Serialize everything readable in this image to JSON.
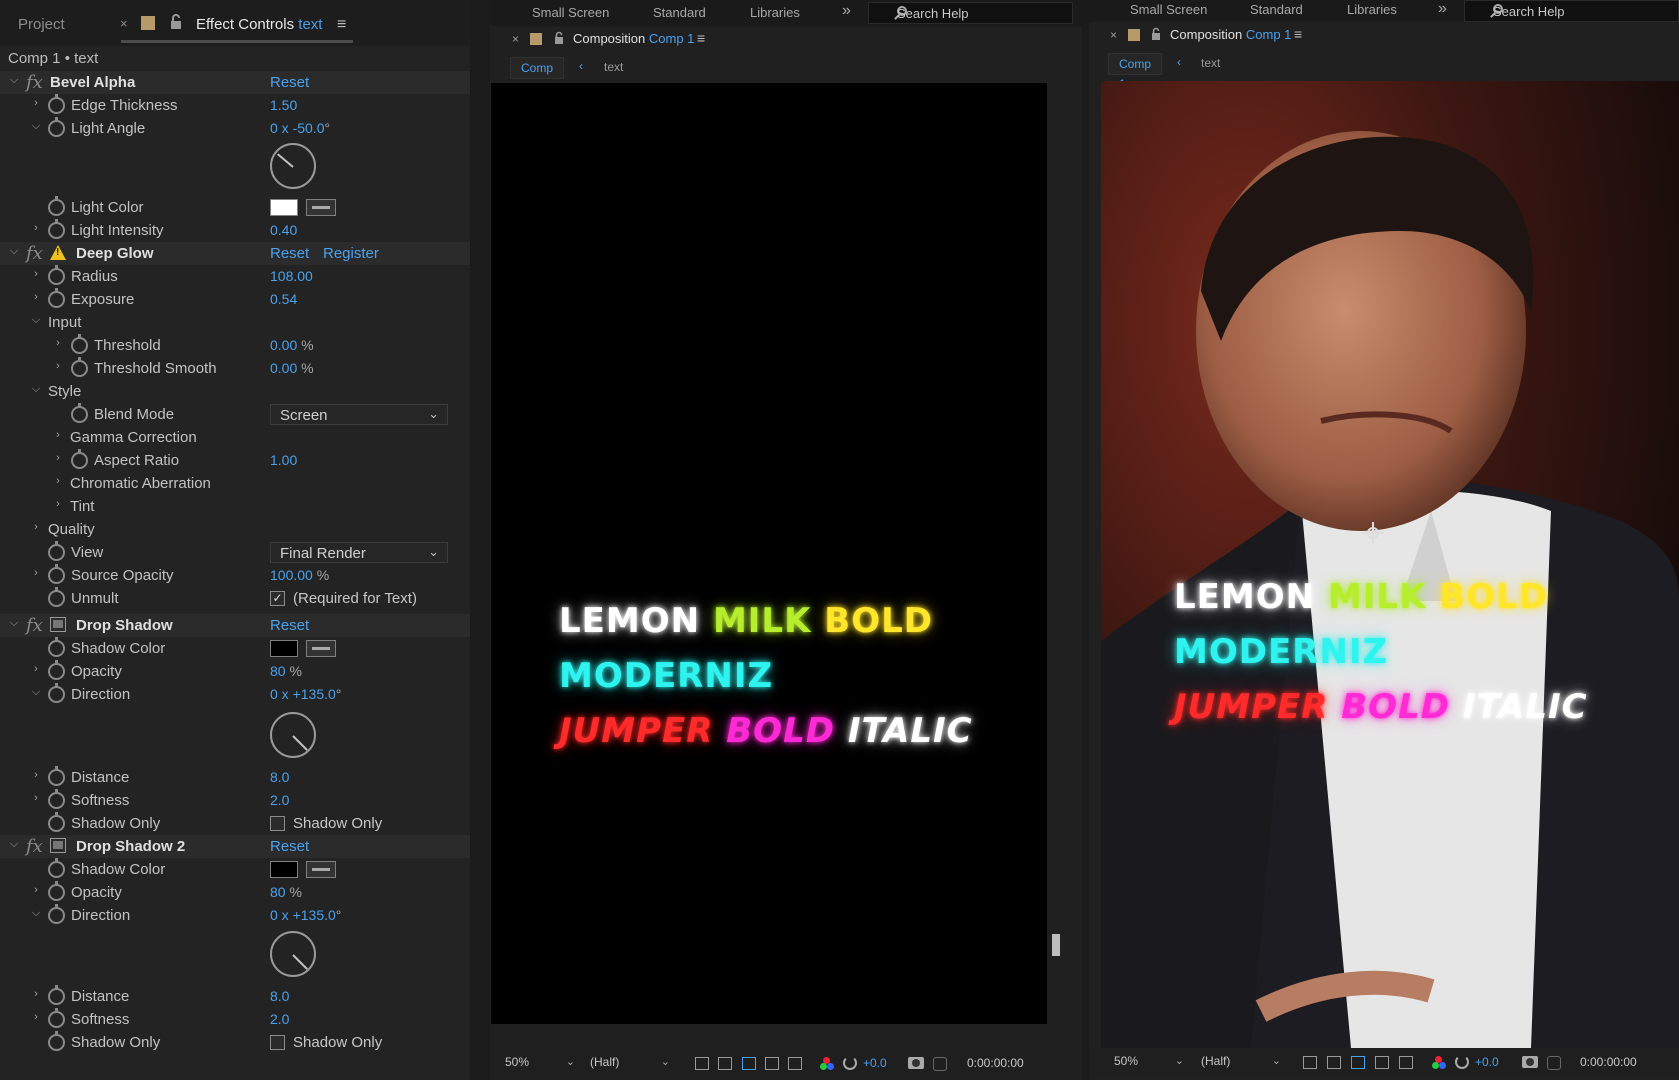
{
  "workspace": {
    "items": [
      "Small Screen",
      "Standard",
      "Libraries"
    ],
    "more": "»",
    "search_label": "Search Help"
  },
  "left_panel": {
    "project_tab": "Project",
    "close": "×",
    "effect_tab": "Effect Controls",
    "effect_tab_layer": "text",
    "menu": "≡",
    "path": "Comp 1 • text"
  },
  "effects": {
    "bevel": {
      "name": "Bevel Alpha",
      "reset": "Reset",
      "edge_thickness": {
        "label": "Edge Thickness",
        "value": "1.50"
      },
      "light_angle": {
        "label": "Light Angle",
        "value": "0 x -50.0",
        "unit": "°",
        "angle_deg": -50
      },
      "light_color": {
        "label": "Light Color",
        "color": "#ffffff"
      },
      "light_intensity": {
        "label": "Light Intensity",
        "value": "0.40"
      }
    },
    "deep_glow": {
      "name": "Deep Glow",
      "reset": "Reset",
      "register": "Register",
      "radius": {
        "label": "Radius",
        "value": "108.00"
      },
      "exposure": {
        "label": "Exposure",
        "value": "0.54"
      },
      "input": {
        "label": "Input"
      },
      "threshold": {
        "label": "Threshold",
        "value": "0.00",
        "unit": "%"
      },
      "threshold_smooth": {
        "label": "Threshold Smooth",
        "value": "0.00",
        "unit": "%"
      },
      "style": {
        "label": "Style"
      },
      "blend_mode": {
        "label": "Blend Mode",
        "value": "Screen"
      },
      "gamma": {
        "label": "Gamma Correction"
      },
      "aspect": {
        "label": "Aspect Ratio",
        "value": "1.00"
      },
      "chromatic": {
        "label": "Chromatic Aberration"
      },
      "tint": {
        "label": "Tint"
      },
      "quality": {
        "label": "Quality"
      },
      "view": {
        "label": "View",
        "value": "Final Render"
      },
      "source_opacity": {
        "label": "Source Opacity",
        "value": "100.00",
        "unit": "%"
      },
      "unmult": {
        "label": "Unmult",
        "checkbox_label": "(Required for Text)",
        "checked": true
      }
    },
    "drop_shadow": {
      "name": "Drop Shadow",
      "reset": "Reset",
      "shadow_color": {
        "label": "Shadow Color",
        "color": "#000000"
      },
      "opacity": {
        "label": "Opacity",
        "value": "80",
        "unit": "%"
      },
      "direction": {
        "label": "Direction",
        "value": "0 x +135.0",
        "unit": "°",
        "angle_deg": 135
      },
      "distance": {
        "label": "Distance",
        "value": "8.0"
      },
      "softness": {
        "label": "Softness",
        "value": "2.0"
      },
      "shadow_only": {
        "label": "Shadow Only",
        "checkbox_label": "Shadow Only",
        "checked": false
      }
    },
    "drop_shadow2": {
      "name": "Drop Shadow 2",
      "reset": "Reset",
      "shadow_color": {
        "label": "Shadow Color",
        "color": "#000000"
      },
      "opacity": {
        "label": "Opacity",
        "value": "80",
        "unit": "%"
      },
      "direction": {
        "label": "Direction",
        "value": "0 x +135.0",
        "unit": "°",
        "angle_deg": 135
      },
      "distance": {
        "label": "Distance",
        "value": "8.0"
      },
      "softness": {
        "label": "Softness",
        "value": "2.0"
      },
      "shadow_only": {
        "label": "Shadow Only",
        "checkbox_label": "Shadow Only",
        "checked": false
      }
    }
  },
  "composition": {
    "close": "×",
    "title_prefix": "Composition",
    "comp_name": "Comp 1",
    "crumb_active": "Comp 1",
    "crumb_sep": "‹",
    "crumb_layer": "text",
    "line1": {
      "w1": "LEMON",
      "w2": "MILK",
      "w3": "BOLD"
    },
    "line2": "MODERNIZ",
    "line3": {
      "w1": "JUMPER",
      "w2": "BOLD",
      "w3": "ITALIC"
    },
    "zoom": "50%",
    "resolution": "(Half)",
    "exposure": "+0.0",
    "timecode": "0:00:00:00"
  },
  "colors": {
    "accent": "#4aa2ee",
    "glow_white": "#ffffff",
    "glow_green": "#b6ee2e",
    "glow_yellow": "#ffe62a",
    "glow_cyan": "#2ff3ee",
    "glow_red": "#ff2a2a",
    "glow_magenta": "#ff2ad5"
  }
}
